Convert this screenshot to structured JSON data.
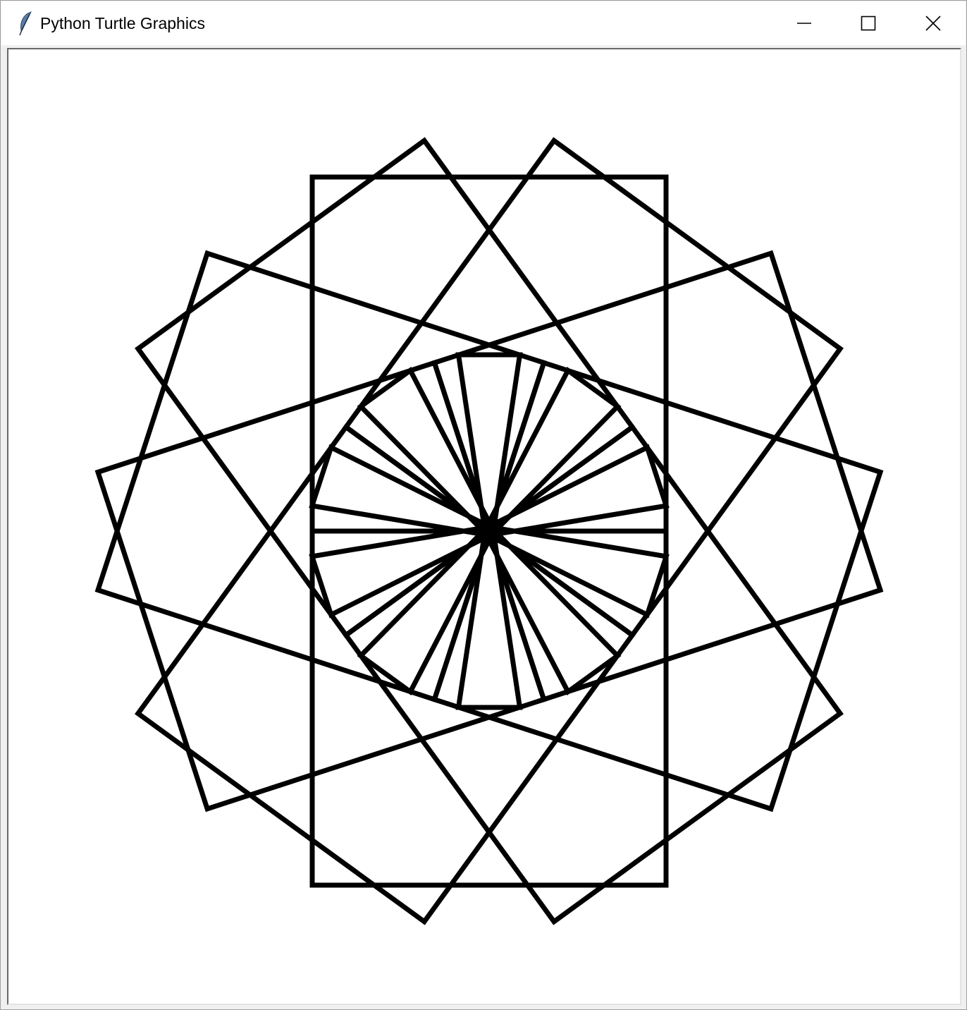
{
  "window": {
    "title": "Python Turtle Graphics",
    "icon": "feather-icon",
    "controls": [
      "minimize-icon",
      "maximize-icon",
      "close-icon"
    ]
  },
  "drawing": {
    "line_color": "#000000",
    "background": "#ffffff",
    "shapes": [
      {
        "name": "square",
        "count": 1
      },
      {
        "name": "tilted-square",
        "count": 9
      },
      {
        "name": "narrow-rectangle",
        "count": 9
      }
    ]
  }
}
